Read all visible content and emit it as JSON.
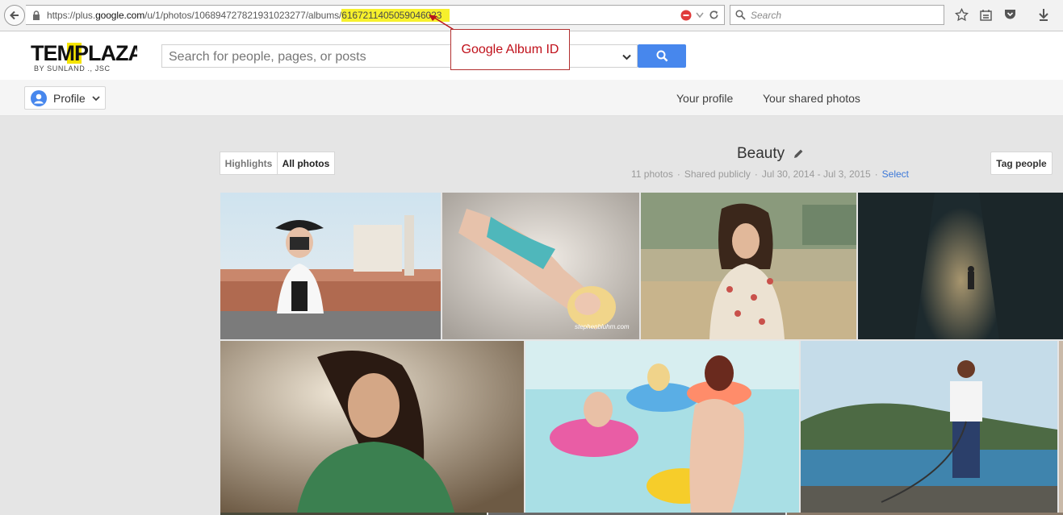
{
  "browser": {
    "url_prefix": "https://plus.",
    "url_domain": "google.com",
    "url_path": "/u/1/photos/106894727821931023277/albums/",
    "url_album_id": "6167211405059046023",
    "search_placeholder": "Search"
  },
  "header": {
    "logo_main": "TEMPLAZA",
    "logo_sub": "BY SUNLAND ., JSC",
    "search_placeholder": "Search for people, pages, or posts"
  },
  "annotation": {
    "label": "Google Album ID"
  },
  "nav": {
    "profile_label": "Profile",
    "your_profile": "Your profile",
    "your_shared_photos": "Your shared photos"
  },
  "album": {
    "tabs": [
      "Highlights",
      "All photos"
    ],
    "active_tab": "All photos",
    "title": "Beauty",
    "photo_count": "11 photos",
    "sharing": "Shared publicly",
    "date_range": "Jul 30, 2014 - Jul 3, 2015",
    "select_label": "Select",
    "tag_people_label": "Tag people",
    "watermark": "stephenbluhm.com"
  },
  "colors": {
    "accent_blue": "#4787ed",
    "highlight_yellow": "#f6f02c",
    "callout_red": "#c0101a",
    "link_blue": "#3c78d8"
  }
}
